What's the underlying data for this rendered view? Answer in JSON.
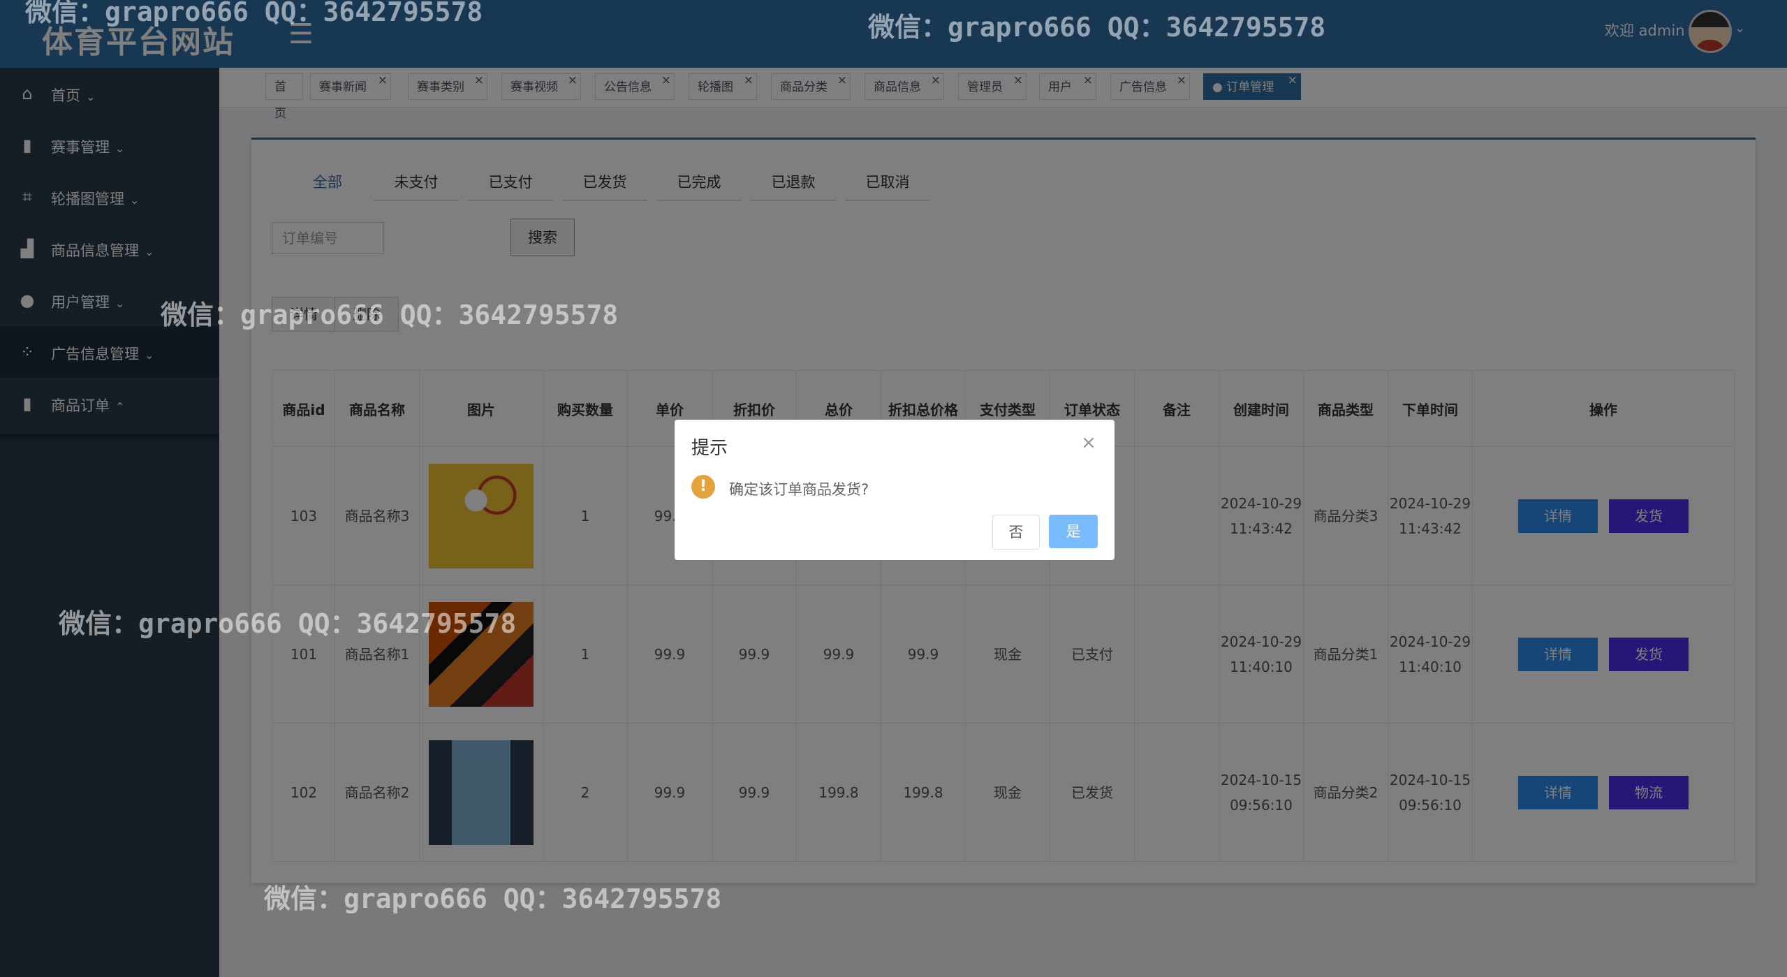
{
  "header": {
    "site_title": "体育平台网站",
    "menu_toggle_icon": "menu-fold-icon",
    "welcome": "欢迎 admin",
    "dropdown_icon": "chevron-down-icon"
  },
  "watermark": "微信：grapro666 QQ：3642795578",
  "sidebar": {
    "items": [
      {
        "label": "首页",
        "icon": "home-icon",
        "chevron": "⌄"
      },
      {
        "label": "赛事管理",
        "icon": "book-icon",
        "chevron": "⌄"
      },
      {
        "label": "轮播图管理",
        "icon": "crop-icon",
        "chevron": "⌄"
      },
      {
        "label": "商品信息管理",
        "icon": "chart-icon",
        "chevron": "⌄"
      },
      {
        "label": "用户管理",
        "icon": "user-icon",
        "chevron": "⌄"
      },
      {
        "label": "广告信息管理",
        "icon": "grid-icon",
        "chevron": "⌄"
      },
      {
        "label": "商品订单",
        "icon": "book-icon",
        "chevron": "⌃"
      }
    ]
  },
  "tabs": [
    {
      "label": "首页",
      "closable": false
    },
    {
      "label": "赛事新闻",
      "closable": true
    },
    {
      "label": "赛事类别",
      "closable": true
    },
    {
      "label": "赛事视频",
      "closable": true
    },
    {
      "label": "公告信息",
      "closable": true
    },
    {
      "label": "轮播图",
      "closable": true
    },
    {
      "label": "商品分类",
      "closable": true
    },
    {
      "label": "商品信息",
      "closable": true
    },
    {
      "label": "管理员",
      "closable": true
    },
    {
      "label": "用户",
      "closable": true
    },
    {
      "label": "广告信息",
      "closable": true
    },
    {
      "label": "● 订单管理",
      "closable": true,
      "active": true
    }
  ],
  "status_tabs": [
    "全部",
    "未支付",
    "已支付",
    "已发货",
    "已完成",
    "已退款",
    "已取消"
  ],
  "search": {
    "placeholder": "订单编号",
    "button": "搜索"
  },
  "bulk_buttons": {
    "detail": "详情",
    "delete": "删除"
  },
  "table": {
    "headers": [
      "商品id",
      "商品名称",
      "图片",
      "购买数量",
      "单价",
      "折扣价",
      "总价",
      "折扣总价格",
      "支付类型",
      "订单状态",
      "备注",
      "创建时间",
      "商品类型",
      "下单时间",
      "操作"
    ],
    "rows": [
      {
        "id": "103",
        "name": "商品名称3",
        "qty": "1",
        "price": "99.9",
        "discount": "",
        "total": "",
        "discount_total": "",
        "pay_type": "",
        "status": "",
        "note": "",
        "created": "2024-10-29 11:43:42",
        "category": "商品分类3",
        "ordered": "2024-10-29 11:43:42",
        "btn1": "详情",
        "btn2": "发货"
      },
      {
        "id": "101",
        "name": "商品名称1",
        "qty": "1",
        "price": "99.9",
        "discount": "99.9",
        "total": "99.9",
        "discount_total": "99.9",
        "pay_type": "现金",
        "status": "已支付",
        "note": "",
        "created": "2024-10-29 11:40:10",
        "category": "商品分类1",
        "ordered": "2024-10-29 11:40:10",
        "btn1": "详情",
        "btn2": "发货"
      },
      {
        "id": "102",
        "name": "商品名称2",
        "qty": "2",
        "price": "99.9",
        "discount": "99.9",
        "total": "199.8",
        "discount_total": "199.8",
        "pay_type": "现金",
        "status": "已发货",
        "note": "",
        "created": "2024-10-15 09:56:10",
        "category": "商品分类2",
        "ordered": "2024-10-15 09:56:10",
        "btn1": "详情",
        "btn2": "物流"
      }
    ]
  },
  "dialog": {
    "title": "提示",
    "message": "确定该订单商品发货?",
    "cancel": "否",
    "confirm": "是",
    "warning_icon": "warning-icon",
    "close_icon": "close-icon"
  }
}
